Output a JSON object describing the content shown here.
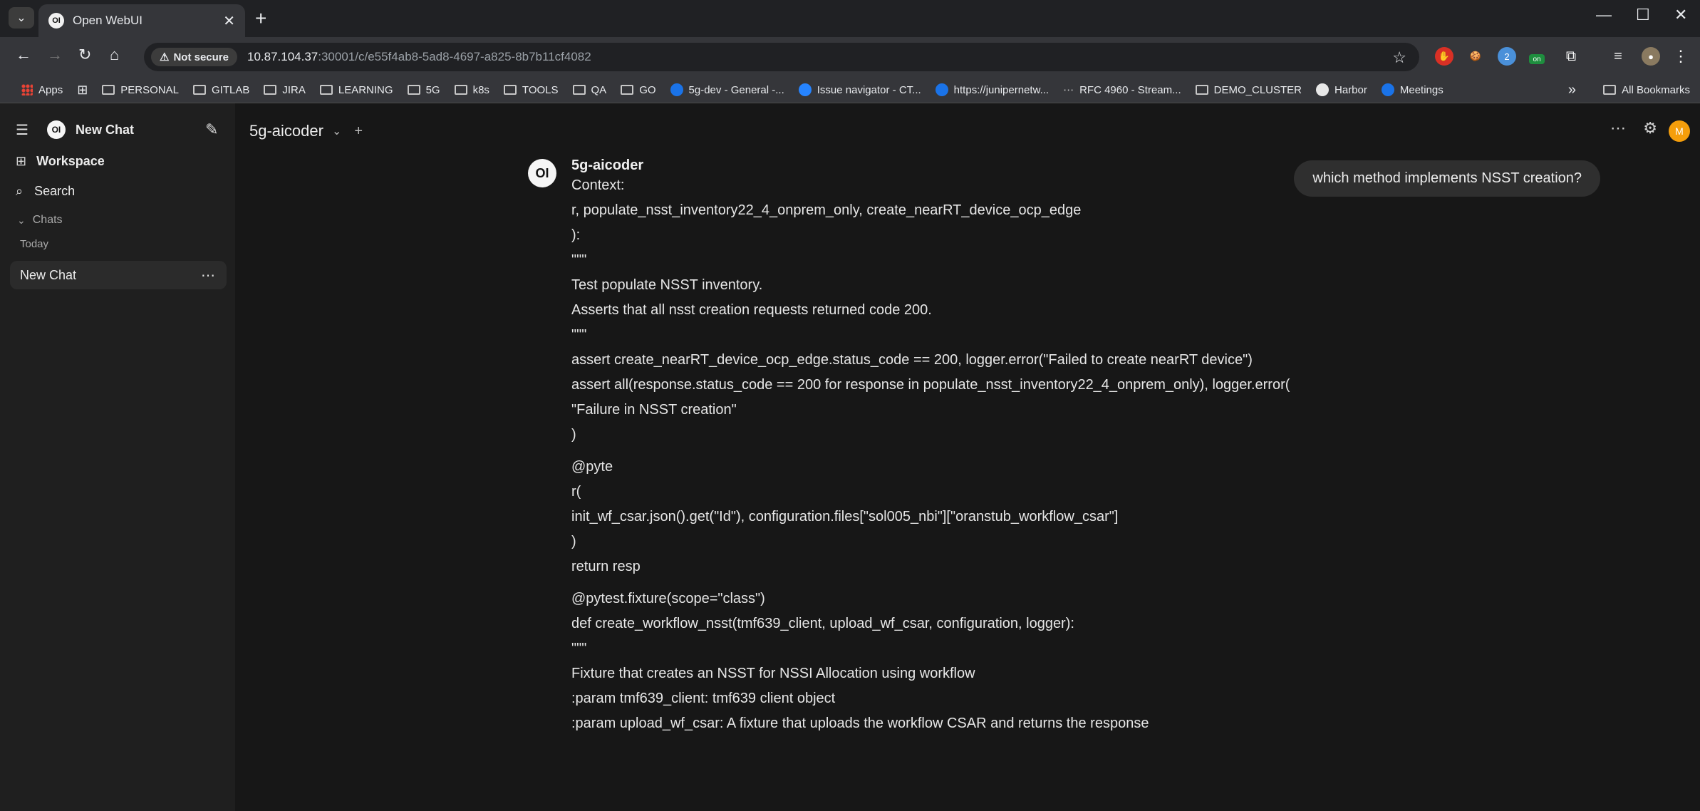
{
  "browser": {
    "tab_title": "Open WebUI",
    "tab_favicon": "OI",
    "url_host": "10.87.104.37",
    "url_rest": ":30001/c/e55f4ab8-5ad8-4697-a825-8b7b11cf4082",
    "security_label": "Not secure",
    "extension_badge": "2",
    "extension_on": "on",
    "bookmarks": [
      "Apps",
      "PERSONAL",
      "GITLAB",
      "JIRA",
      "LEARNING",
      "5G",
      "k8s",
      "TOOLS",
      "QA",
      "GO",
      "5g-dev - General -...",
      "Issue navigator - CT...",
      "https://junipernetw...",
      "RFC 4960 - Stream...",
      "DEMO_CLUSTER",
      "Harbor",
      "Meetings"
    ],
    "all_bookmarks": "All Bookmarks"
  },
  "sidebar": {
    "logo": "OI",
    "new_chat": "New Chat",
    "workspace": "Workspace",
    "search": "Search",
    "chats_header": "Chats",
    "today": "Today",
    "chat_item": "New Chat"
  },
  "header": {
    "model": "5g-aicoder",
    "avatar": "M"
  },
  "conversation": {
    "user_message": "which method implements NSST creation?",
    "bot_avatar": "OI",
    "bot_name": "5g-aicoder",
    "paragraphs": [
      [
        "Context:",
        "r, populate_nsst_inventory22_4_onprem_only, create_nearRT_device_ocp_edge",
        "):",
        "\"\"\"",
        "Test populate NSST inventory.",
        "Asserts that all nsst creation requests returned code 200.",
        "\"\"\"",
        "assert create_nearRT_device_ocp_edge.status_code == 200, logger.error(\"Failed to create nearRT device\")",
        "assert all(response.status_code == 200 for response in populate_nsst_inventory22_4_onprem_only), logger.error(",
        "\"Failure in NSST creation\"",
        ")"
      ],
      [
        "@pyte",
        "r(",
        "init_wf_csar.json().get(\"Id\"), configuration.files[\"sol005_nbi\"][\"oranstub_workflow_csar\"]",
        ")",
        "return resp"
      ],
      [
        "@pytest.fixture(scope=\"class\")",
        "def create_workflow_nsst(tmf639_client, upload_wf_csar, configuration, logger):",
        "\"\"\"",
        "Fixture that creates an NSST for NSSI Allocation using workflow",
        ":param tmf639_client: tmf639 client object",
        ":param upload_wf_csar: A fixture that uploads the workflow CSAR and returns the response"
      ]
    ]
  }
}
